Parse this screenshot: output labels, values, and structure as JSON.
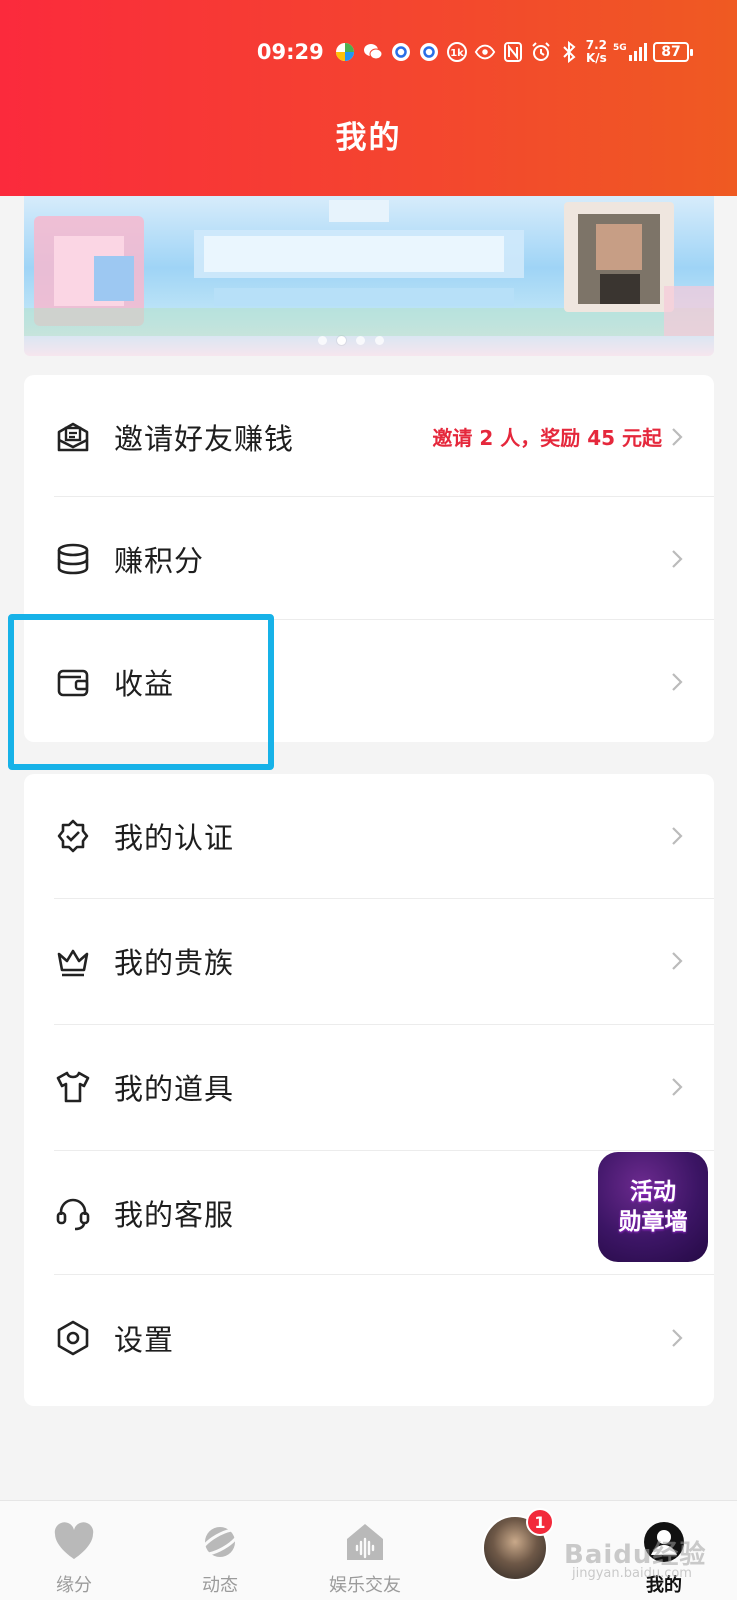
{
  "status_bar": {
    "time": "09:29",
    "net_speed_value": "7.2",
    "net_speed_unit": "K/s",
    "network": "5G",
    "battery": "87",
    "icons": [
      "app-icon",
      "wechat-icon",
      "chat-icon",
      "chat-icon",
      "nfc-icon",
      "eye-icon",
      "nfc-icon",
      "alarm-icon",
      "bluetooth-icon",
      "signal-icon",
      "battery-icon"
    ]
  },
  "header": {
    "title": "我的",
    "color_start": "#fb2a3c",
    "color_end": "#ef5a22"
  },
  "banner": {
    "dot_count": 4,
    "active_dot": 1
  },
  "menu_group1": [
    {
      "label": "邀请好友赚钱",
      "hint": "邀请 2 人，奖励 45 元起",
      "icon": "envelope-icon"
    },
    {
      "label": "赚积分",
      "icon": "coins-icon"
    },
    {
      "label": "收益",
      "icon": "wallet-icon"
    }
  ],
  "menu_group2": [
    {
      "label": "我的认证",
      "icon": "badge-check-icon"
    },
    {
      "label": "我的贵族",
      "icon": "crown-icon"
    },
    {
      "label": "我的道具",
      "icon": "tshirt-icon"
    },
    {
      "label": "我的客服",
      "icon": "headset-icon"
    },
    {
      "label": "设置",
      "icon": "settings-icon"
    }
  ],
  "activity_badge": {
    "line1": "活动",
    "line2": "勋章墙"
  },
  "bottom_nav": [
    {
      "label": "缘分",
      "icon": "heart-icon"
    },
    {
      "label": "动态",
      "icon": "planet-icon"
    },
    {
      "label": "娱乐交友",
      "icon": "home-voice-icon"
    },
    {
      "label": "",
      "icon": "avatar"
    },
    {
      "label": "我的",
      "icon": "profile-icon"
    }
  ],
  "nav_badge": "1",
  "watermark": {
    "text": "Baidu经验",
    "sub": "jingyan.baidu.com"
  },
  "accent_color": "#e5283c",
  "highlight_color": "#17b2e8"
}
